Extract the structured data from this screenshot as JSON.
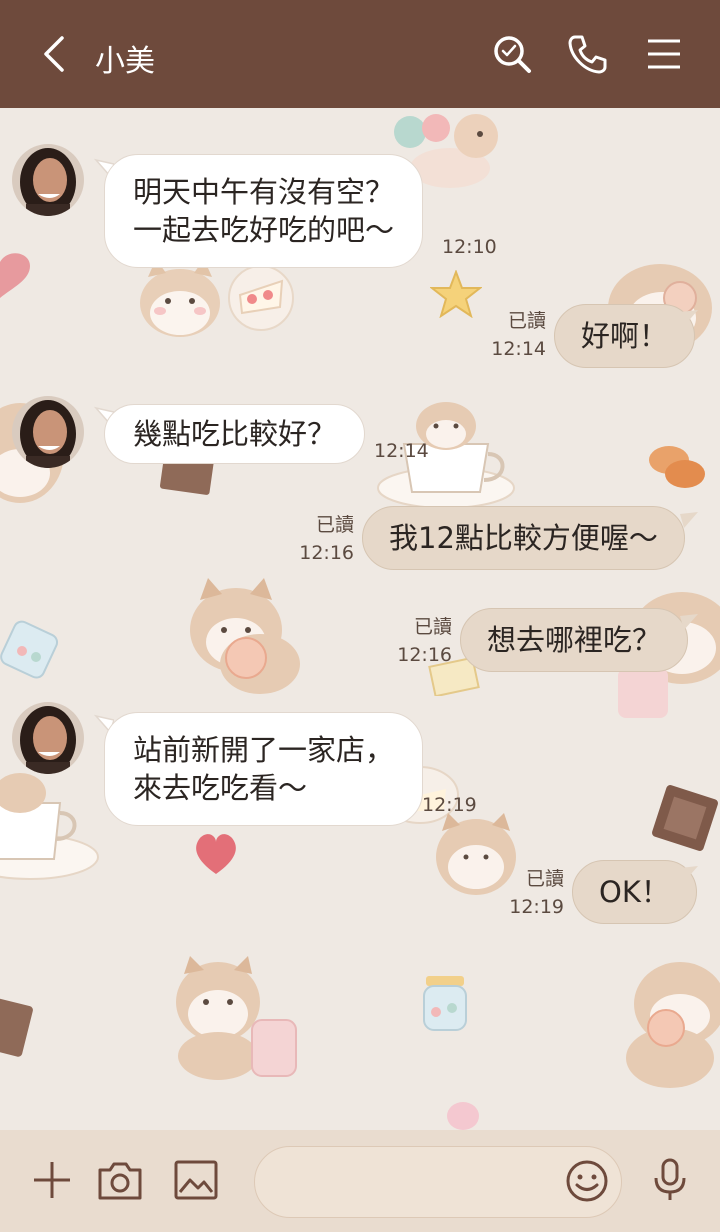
{
  "header": {
    "title": "小美",
    "icons": [
      "back-arrow-icon",
      "search-icon",
      "phone-icon",
      "menu-icon"
    ],
    "color": "#6e4a3c"
  },
  "messages": [
    {
      "side": "left",
      "lines": [
        "明天中午有沒有空？",
        "一起去吃好吃的吧～"
      ],
      "time": "12:10"
    },
    {
      "side": "right",
      "lines": [
        "好啊！"
      ],
      "read": "已讀",
      "time": "12:14"
    },
    {
      "side": "left",
      "lines": [
        "幾點吃比較好？"
      ],
      "time": "12:14"
    },
    {
      "side": "right",
      "lines": [
        "我12點比較方便喔～"
      ],
      "read": "已讀",
      "time": "12:16"
    },
    {
      "side": "right",
      "lines": [
        "想去哪裡吃？"
      ],
      "read": "已讀",
      "time": "12:16"
    },
    {
      "side": "left",
      "lines": [
        "站前新開了一家店，",
        "來去吃吃看～"
      ],
      "time": "12:19"
    },
    {
      "side": "right",
      "lines": [
        "OK！"
      ],
      "read": "已讀",
      "time": "12:19"
    }
  ],
  "input_bar": {
    "placeholder": "",
    "icons": [
      "plus-icon",
      "camera-icon",
      "image-icon",
      "emoji-icon",
      "microphone-icon"
    ]
  },
  "colors": {
    "background": "#efe9e3",
    "left_bubble": "#ffffff",
    "right_bubble": "#e6d8c9",
    "input_bar": "#e9dccf"
  }
}
